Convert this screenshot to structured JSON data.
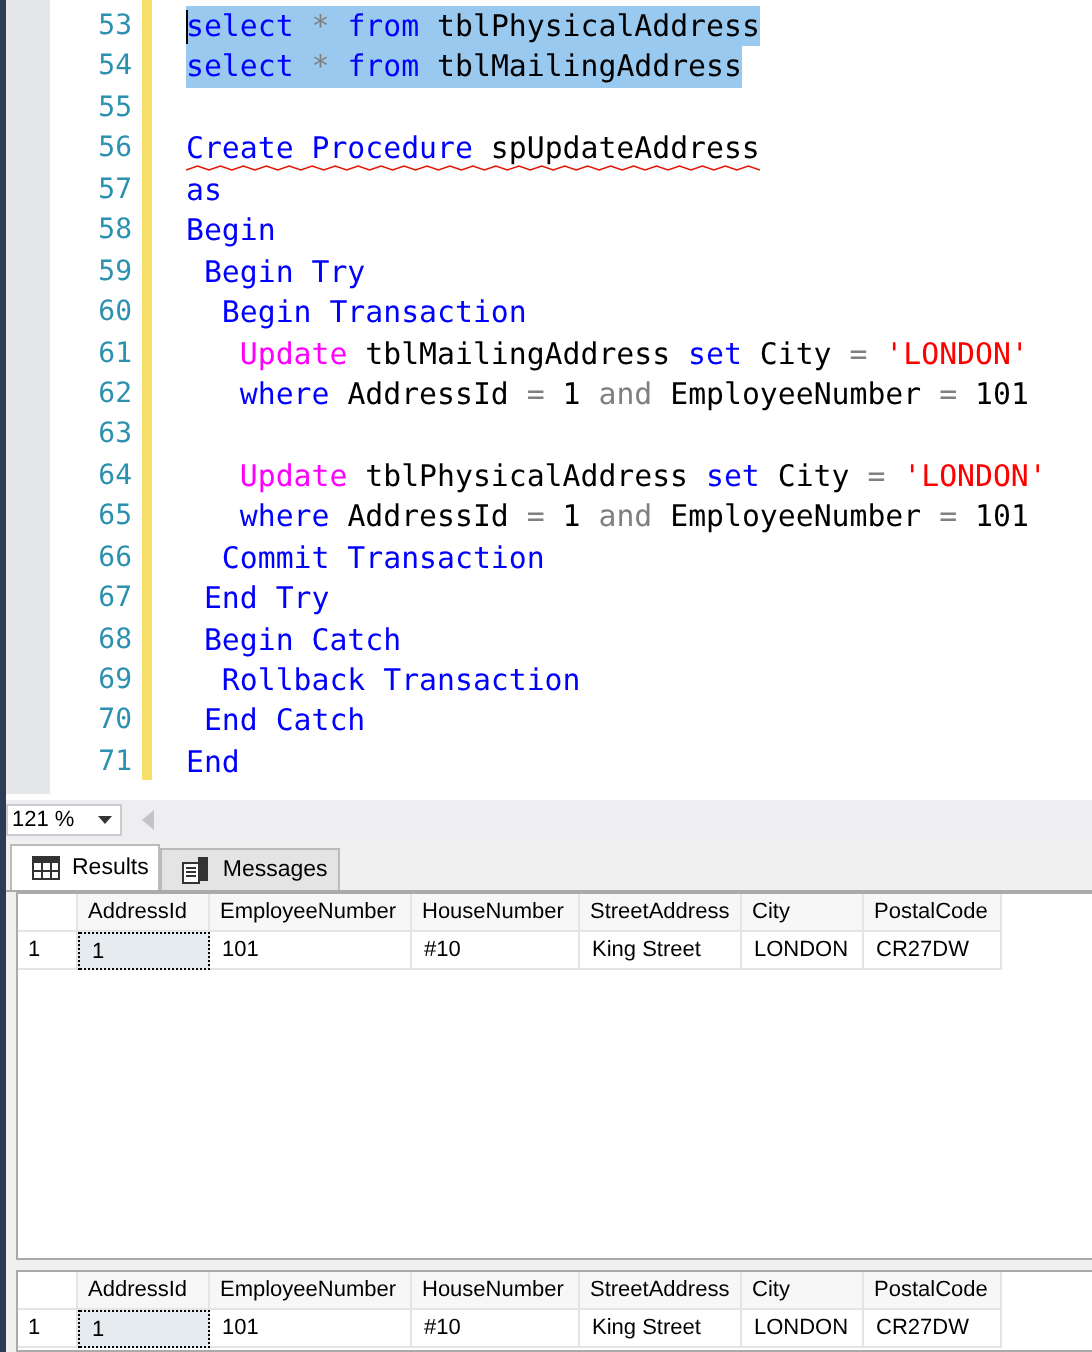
{
  "editor": {
    "lines": [
      {
        "number": "53",
        "selected": true,
        "error": false,
        "tokens": [
          {
            "text": "select",
            "kind": "kw"
          },
          {
            "text": " * ",
            "kind": "op"
          },
          {
            "text": "from",
            "kind": "kw"
          },
          {
            "text": " tblPhysicalAddress",
            "kind": "id"
          }
        ]
      },
      {
        "number": "54",
        "selected": true,
        "error": false,
        "tokens": [
          {
            "text": "select",
            "kind": "kw"
          },
          {
            "text": " * ",
            "kind": "op"
          },
          {
            "text": "from",
            "kind": "kw"
          },
          {
            "text": " tblMailingAddress",
            "kind": "id"
          }
        ]
      },
      {
        "number": "55"
      },
      {
        "number": "56",
        "selected": false,
        "error": true,
        "tokens": [
          {
            "text": "Create Procedure",
            "kind": "kw"
          },
          {
            "text": " spUpdateAddress",
            "kind": "id"
          }
        ]
      },
      {
        "number": "57",
        "selected": false,
        "error": false,
        "tokens": [
          {
            "text": "as",
            "kind": "kw"
          }
        ]
      },
      {
        "number": "58",
        "selected": false,
        "error": false,
        "tokens": [
          {
            "text": "Begin",
            "kind": "kw"
          }
        ]
      },
      {
        "number": "59",
        "selected": false,
        "error": false,
        "tokens": [
          {
            "text": " Begin Try",
            "kind": "kw"
          }
        ]
      },
      {
        "number": "60",
        "selected": false,
        "error": false,
        "tokens": [
          {
            "text": "  Begin Transaction",
            "kind": "kw"
          }
        ]
      },
      {
        "number": "61",
        "selected": false,
        "error": false,
        "tokens": [
          {
            "text": "   Update",
            "kind": "fn"
          },
          {
            "text": " tblMailingAddress ",
            "kind": "id"
          },
          {
            "text": "set",
            "kind": "kw"
          },
          {
            "text": " City ",
            "kind": "id"
          },
          {
            "text": "=",
            "kind": "op"
          },
          {
            "text": " 'LONDON'",
            "kind": "str"
          }
        ]
      },
      {
        "number": "62",
        "selected": false,
        "error": false,
        "tokens": [
          {
            "text": "   where",
            "kind": "kw"
          },
          {
            "text": " AddressId ",
            "kind": "id"
          },
          {
            "text": "=",
            "kind": "op"
          },
          {
            "text": " 1 ",
            "kind": "id"
          },
          {
            "text": "and",
            "kind": "op"
          },
          {
            "text": " EmployeeNumber ",
            "kind": "id"
          },
          {
            "text": "=",
            "kind": "op"
          },
          {
            "text": " 101",
            "kind": "id"
          }
        ]
      },
      {
        "number": "63"
      },
      {
        "number": "64",
        "selected": false,
        "error": false,
        "tokens": [
          {
            "text": "   Update",
            "kind": "fn"
          },
          {
            "text": " tblPhysicalAddress ",
            "kind": "id"
          },
          {
            "text": "set",
            "kind": "kw"
          },
          {
            "text": " City ",
            "kind": "id"
          },
          {
            "text": "=",
            "kind": "op"
          },
          {
            "text": " 'LONDON'",
            "kind": "str"
          }
        ]
      },
      {
        "number": "65",
        "selected": false,
        "error": false,
        "tokens": [
          {
            "text": "   where",
            "kind": "kw"
          },
          {
            "text": " AddressId ",
            "kind": "id"
          },
          {
            "text": "=",
            "kind": "op"
          },
          {
            "text": " 1 ",
            "kind": "id"
          },
          {
            "text": "and",
            "kind": "op"
          },
          {
            "text": " EmployeeNumber ",
            "kind": "id"
          },
          {
            "text": "=",
            "kind": "op"
          },
          {
            "text": " 101",
            "kind": "id"
          }
        ]
      },
      {
        "number": "66",
        "selected": false,
        "error": false,
        "tokens": [
          {
            "text": "  Commit Transaction",
            "kind": "kw"
          }
        ]
      },
      {
        "number": "67",
        "selected": false,
        "error": false,
        "tokens": [
          {
            "text": " End Try",
            "kind": "kw"
          }
        ]
      },
      {
        "number": "68",
        "selected": false,
        "error": false,
        "tokens": [
          {
            "text": " Begin Catch",
            "kind": "kw"
          }
        ]
      },
      {
        "number": "69",
        "selected": false,
        "error": false,
        "tokens": [
          {
            "text": "  Rollback Transaction",
            "kind": "kw"
          }
        ]
      },
      {
        "number": "70",
        "selected": false,
        "error": false,
        "tokens": [
          {
            "text": " End Catch",
            "kind": "kw"
          }
        ]
      },
      {
        "number": "71",
        "selected": false,
        "error": false,
        "tokens": [
          {
            "text": "End",
            "kind": "kw"
          }
        ]
      }
    ]
  },
  "zoom": {
    "value": "121 %"
  },
  "tabs": [
    {
      "label": "Results",
      "selected": true
    },
    {
      "label": "Messages",
      "selected": false
    }
  ],
  "grids": [
    {
      "columns": [
        "AddressId",
        "EmployeeNumber",
        "HouseNumber",
        "StreetAddress",
        "City",
        "PostalCode"
      ],
      "rows": [
        {
          "header": "1",
          "cells": [
            {
              "text": "1",
              "focused": true
            },
            {
              "text": "101",
              "focused": false
            },
            {
              "text": "#10",
              "focused": false
            },
            {
              "text": "King Street",
              "focused": false
            },
            {
              "text": "LONDON",
              "focused": false
            },
            {
              "text": "CR27DW",
              "focused": false
            }
          ]
        }
      ]
    },
    {
      "columns": [
        "AddressId",
        "EmployeeNumber",
        "HouseNumber",
        "StreetAddress",
        "City",
        "PostalCode"
      ],
      "rows": [
        {
          "header": "1",
          "cells": [
            {
              "text": "1",
              "focused": true
            },
            {
              "text": "101",
              "focused": false
            },
            {
              "text": "#10",
              "focused": false
            },
            {
              "text": "King Street",
              "focused": false
            },
            {
              "text": "LONDON",
              "focused": false
            },
            {
              "text": "CR27DW",
              "focused": false
            }
          ]
        }
      ]
    }
  ]
}
